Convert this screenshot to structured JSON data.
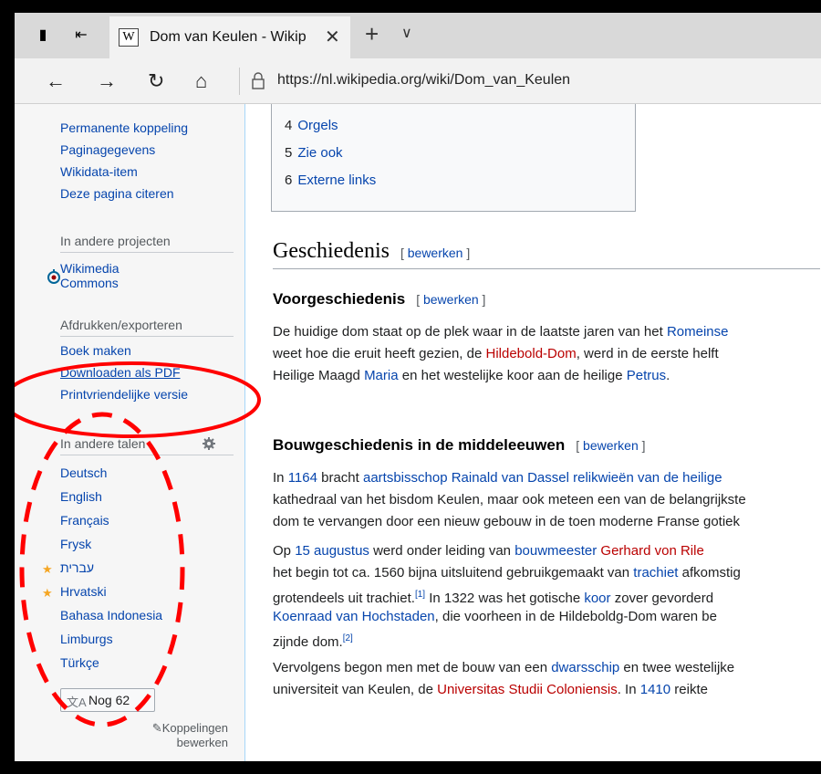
{
  "tab": {
    "title": "Dom van Keulen - Wikip",
    "favicon": "W"
  },
  "address": {
    "url": "https://nl.wikipedia.org/wiki/Dom_van_Keulen"
  },
  "sidebar": {
    "tools": [
      "Permanente koppeling",
      "Paginagegevens",
      "Wikidata-item",
      "Deze pagina citeren"
    ],
    "projects_header": "In andere projecten",
    "commons": [
      "Wikimedia",
      "Commons"
    ],
    "print_header": "Afdrukken/exporteren",
    "print_items": [
      "Boek maken",
      "Downloaden als PDF",
      "Printvriendelijke versie"
    ],
    "lang_header": "In andere talen",
    "languages": [
      "Deutsch",
      "English",
      "Français",
      "Frysk",
      "עברית",
      "Hrvatski",
      "Bahasa Indonesia",
      "Limburgs",
      "Türkçe"
    ],
    "more_button": "Nog 62",
    "edit_links": [
      "Koppelingen",
      "bewerken"
    ]
  },
  "toc": [
    {
      "num": "4",
      "label": "Orgels"
    },
    {
      "num": "5",
      "label": "Zie ook"
    },
    {
      "num": "6",
      "label": "Externe links"
    }
  ],
  "article": {
    "h2": "Geschiedenis",
    "edit_label": "bewerken",
    "h3a": "Voorgeschiedenis",
    "h3b": "Bouwgeschiedenis in de middeleeuwen"
  },
  "colors": {
    "link": "#0645ad",
    "redlink": "#ba0000",
    "annotation": "#ff0000",
    "star": "#f5a623"
  },
  "icons": [
    "back-arrow-icon",
    "forward-arrow-icon",
    "refresh-icon",
    "home-icon",
    "lock-icon",
    "gear-icon",
    "close-icon",
    "translate-icon",
    "pencil-icon",
    "star-icon"
  ]
}
